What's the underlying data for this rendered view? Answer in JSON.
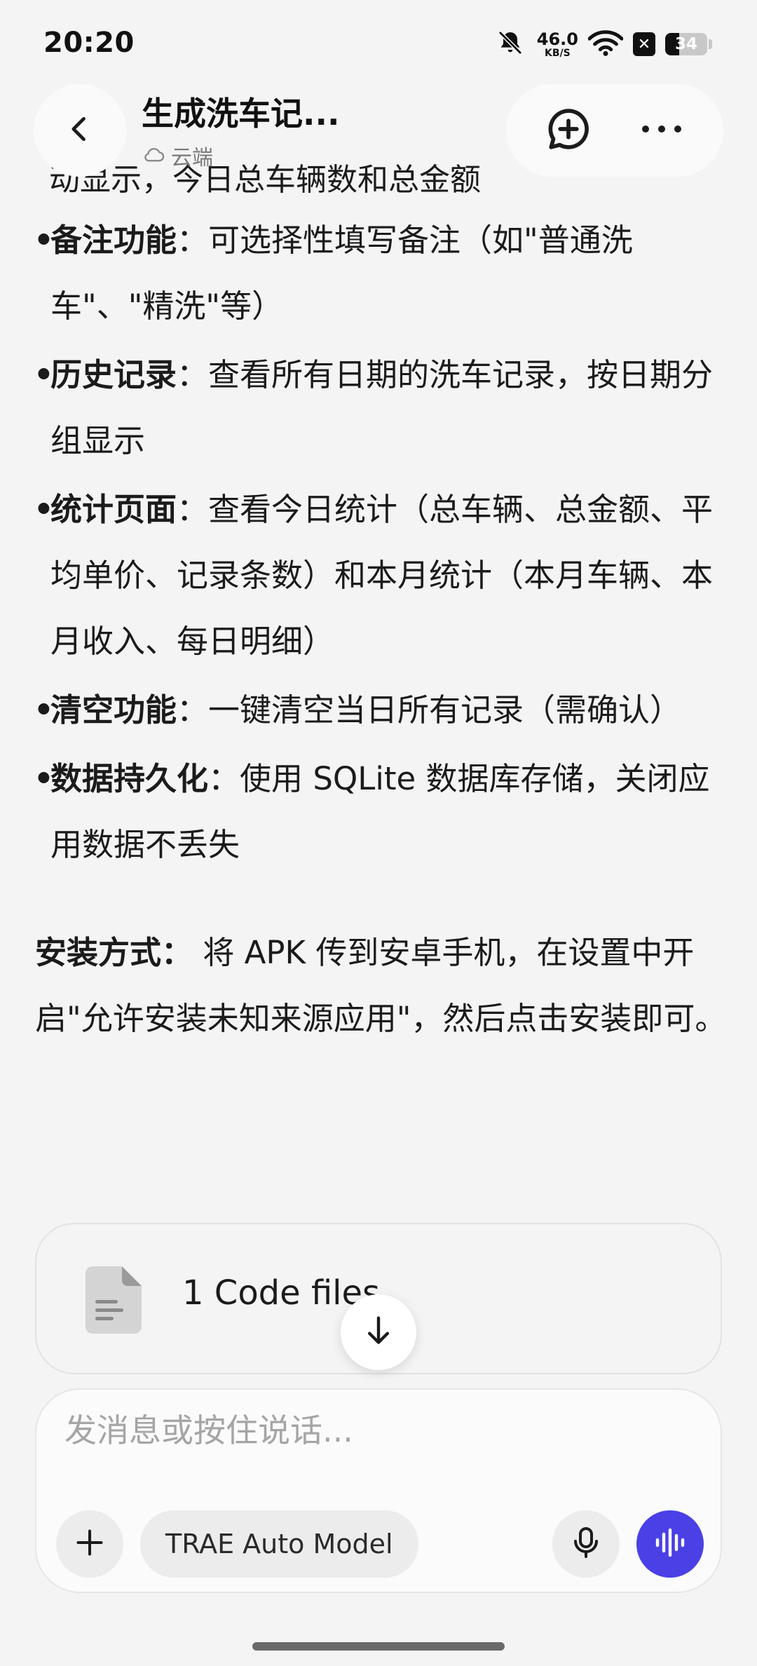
{
  "status_bar": {
    "time": "20:20",
    "net_speed_value": "46.0",
    "net_speed_unit": "KB/S",
    "sim_glyph": "✕",
    "battery": "34",
    "battery_level_percent": 34,
    "icons": [
      "mute-bell-icon",
      "wifi-icon",
      "no-sim-icon",
      "battery-icon"
    ]
  },
  "header": {
    "title": "生成洗车记...",
    "location_label": "云端",
    "icons": [
      "back-chevron-icon",
      "cloud-icon",
      "new-chat-icon",
      "more-icon"
    ]
  },
  "content": {
    "cut_off_line": "动显示，今日总车辆数和总金额",
    "bullets": [
      {
        "label": "备注功能",
        "text": "：可选择性填写备注（如\"普通洗车\"、\"精洗\"等）"
      },
      {
        "label": "历史记录",
        "text": "：查看所有日期的洗车记录，按日期分组显示"
      },
      {
        "label": "统计页面",
        "text": "：查看今日统计（总车辆、总金额、平均单价、记录条数）和本月统计（本月车辆、本月收入、每日明细）"
      },
      {
        "label": "清空功能",
        "text": "：一键清空当日所有记录（需确认）"
      },
      {
        "label": "数据持久化",
        "text": "：使用 SQLite 数据库存储，关闭应用数据不丢失"
      }
    ],
    "bullet_marker": "•",
    "install_label": "安装方式：",
    "install_text": " 将 APK 传到安卓手机，在设置中开启\"允许安装未知来源应用\"，然后点击安装即可。"
  },
  "file_card": {
    "label": "1 Code files",
    "icon": "document-icon"
  },
  "composer": {
    "placeholder": "发消息或按住说话...",
    "value": "",
    "model_label": "TRAE Auto Model",
    "icons": [
      "plus-icon",
      "microphone-icon",
      "voice-wave-icon",
      "arrow-down-icon"
    ],
    "accent_color": "#4a40e6"
  }
}
